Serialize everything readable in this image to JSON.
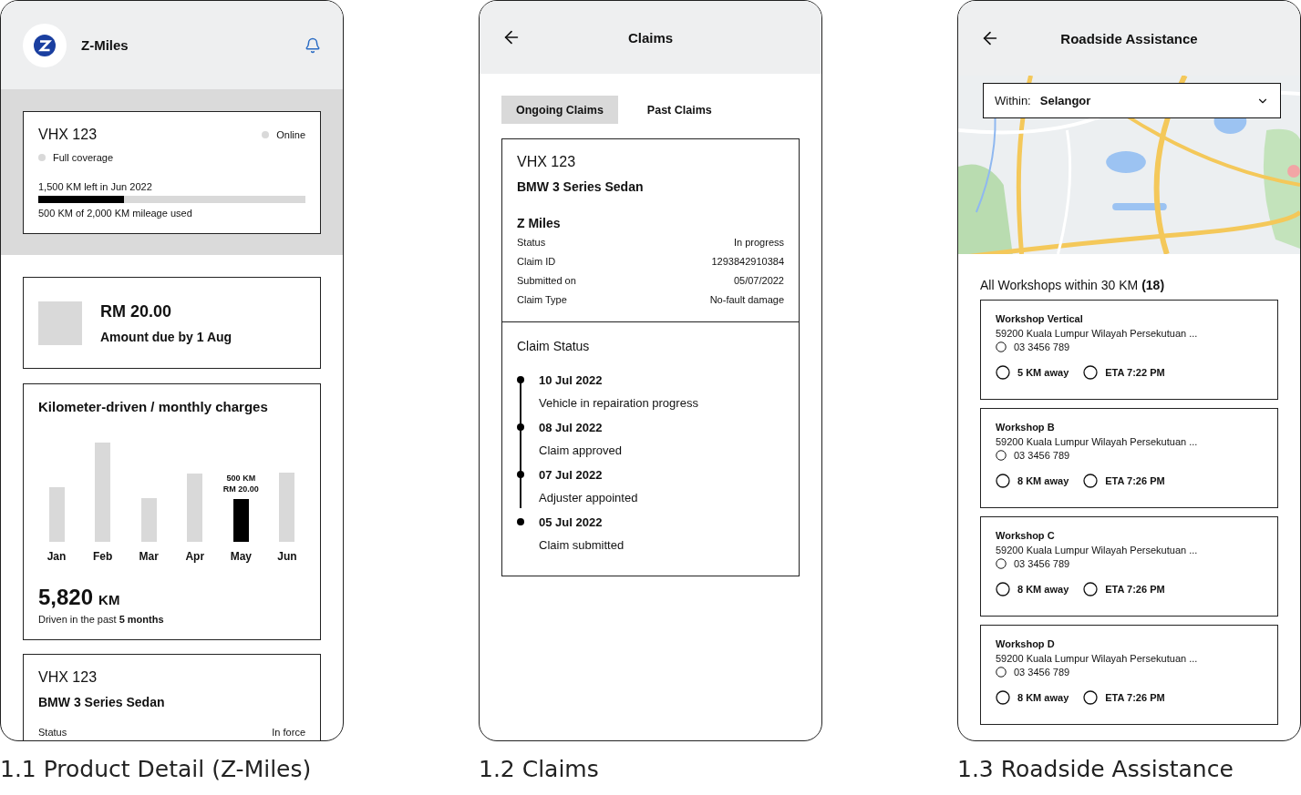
{
  "product_detail": {
    "caption": "1.1 Product Detail (Z-Miles)",
    "header": {
      "title": "Z-Miles"
    },
    "policy_card": {
      "plate": "VHX 123",
      "status": "Online",
      "coverage": "Full coverage",
      "mileage_left": "1,500 KM left in Jun 2022",
      "usage": {
        "level": 0.32
      },
      "usage_text": "500 KM of 2,000 KM mileage used"
    },
    "payment": {
      "amount": "RM 20.00",
      "due": "Amount due by 1 Aug"
    },
    "chart": {
      "title": "Kilometer-driven / monthly charges",
      "months": [
        {
          "label": "Jan",
          "selected": false
        },
        {
          "label": "Feb",
          "selected": false
        },
        {
          "label": "Mar",
          "selected": false
        },
        {
          "label": "Apr",
          "selected": false
        },
        {
          "label": "May",
          "selected": true,
          "value_lines": [
            "500 KM",
            "RM 20.00"
          ]
        },
        {
          "label": "Jun",
          "selected": false
        }
      ],
      "total": "5,820",
      "unit": "KM",
      "note": "Driven in the past **5 months**"
    },
    "vehicle": {
      "plate": "VHX 123",
      "model": "BMW 3 Series Sedan",
      "rows": [
        {
          "label": "Status",
          "value": "In force"
        }
      ]
    }
  },
  "claims": {
    "caption": "1.2 Claims",
    "header": {
      "title": "Claims"
    },
    "tabs": [
      {
        "label": "Ongoing Claims",
        "selected": true
      },
      {
        "label": "Past Claims",
        "selected": false
      }
    ],
    "claim": {
      "plate": "VHX 123",
      "model": "BMW 3 Series Sedan",
      "product": "Z Miles",
      "rows": [
        {
          "label": "Status",
          "value": "In progress"
        },
        {
          "label": "Claim ID",
          "value": "1293842910384"
        },
        {
          "label": "Submitted on",
          "value": "05/07/2022"
        },
        {
          "label": "Claim Type",
          "value": "No-fault damage"
        }
      ]
    },
    "status": {
      "title": "Claim Status",
      "events": [
        {
          "date": "10 Jul 2022",
          "text": "Vehicle in repairation progress"
        },
        {
          "date": "08 Jul 2022",
          "text": "Claim approved"
        },
        {
          "date": "07 Jul 2022",
          "text": "Adjuster appointed"
        },
        {
          "date": "05 Jul 2022",
          "text": "Claim submitted"
        }
      ]
    }
  },
  "roadside": {
    "caption": "1.3 Roadside Assistance",
    "header": {
      "title": "Roadside Assistance"
    },
    "filter": {
      "label": "Within:",
      "value": "Selangor"
    },
    "heading": "All Workshops within 30 KM **(18)**",
    "workshops": [
      {
        "name": "Workshop Vertical",
        "address": "59200 Kuala Lumpur Wilayah Persekutuan ...",
        "phone": "03 3456 789",
        "distance": "5 KM away",
        "eta": "ETA 7:22 PM"
      },
      {
        "name": "Workshop B",
        "address": "59200 Kuala Lumpur Wilayah Persekutuan ...",
        "phone": "03 3456 789",
        "distance": "8 KM away",
        "eta": "ETA 7:26 PM"
      },
      {
        "name": "Workshop C",
        "address": "59200 Kuala Lumpur Wilayah Persekutuan ...",
        "phone": "03 3456 789",
        "distance": "8 KM away",
        "eta": "ETA 7:26 PM"
      },
      {
        "name": "Workshop D",
        "address": "59200 Kuala Lumpur Wilayah Persekutuan ...",
        "phone": "03 3456 789",
        "distance": "8 KM away",
        "eta": "ETA 7:26 PM"
      }
    ]
  }
}
